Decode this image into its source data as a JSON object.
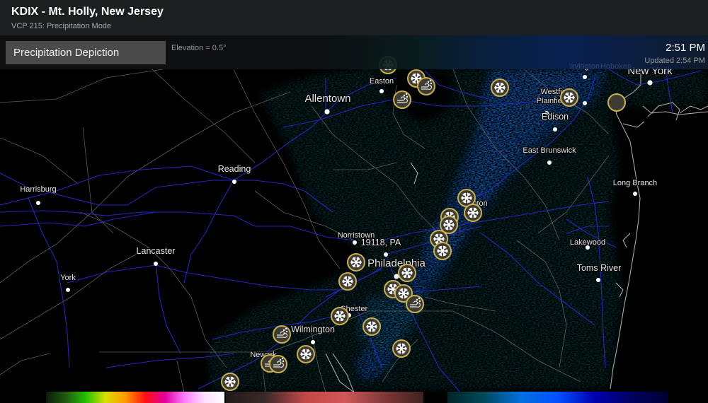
{
  "header": {
    "title": "KDIX - Mt. Holly, New Jersey",
    "subtitle": "VCP 215: Precipitation Mode"
  },
  "toolbar": {
    "product_button": "Precipitation Depiction",
    "elevation": "Elevation = 0.5°",
    "scan_time": "2:51 PM",
    "updated": "Updated 2:54 PM"
  },
  "map": {
    "cities": [
      {
        "name": "Allentown",
        "size": "large"
      },
      {
        "name": "Easton",
        "size": "small"
      },
      {
        "name": "Reading",
        "size": "medium"
      },
      {
        "name": "Harrisburg",
        "size": "small"
      },
      {
        "name": "Lancaster",
        "size": "medium"
      },
      {
        "name": "York",
        "size": "small"
      },
      {
        "name": "Norristown",
        "size": "small"
      },
      {
        "name": "19118, PA",
        "size": "medium"
      },
      {
        "name": "Philadelphia",
        "size": "large"
      },
      {
        "name": "Chester",
        "size": "small"
      },
      {
        "name": "Wilmington",
        "size": "medium"
      },
      {
        "name": "Newark",
        "size": "small"
      },
      {
        "name": "Trenton",
        "size": "small"
      },
      {
        "name": "New York",
        "size": "large"
      },
      {
        "name": "Irvington",
        "size": "small"
      },
      {
        "name": "Hoboken",
        "size": "small"
      },
      {
        "name": "Westfield",
        "size": "small"
      },
      {
        "name": "Plainfield",
        "size": "small"
      },
      {
        "name": "Edison",
        "size": "medium"
      },
      {
        "name": "East Brunswick",
        "size": "small"
      },
      {
        "name": "Long Branch",
        "size": "small"
      },
      {
        "name": "Lakewood",
        "size": "small"
      },
      {
        "name": "Toms River",
        "size": "medium"
      }
    ],
    "markers": [
      {
        "type": "snow"
      },
      {
        "type": "snow"
      },
      {
        "type": "blowing-snow"
      },
      {
        "type": "blowing-snow"
      },
      {
        "type": "snow"
      },
      {
        "type": "snow"
      },
      {
        "type": "empty"
      },
      {
        "type": "snow"
      },
      {
        "type": "snow"
      },
      {
        "type": "snow"
      },
      {
        "type": "snow"
      },
      {
        "type": "snow"
      },
      {
        "type": "snow"
      },
      {
        "type": "snow"
      },
      {
        "type": "snow"
      },
      {
        "type": "snow"
      },
      {
        "type": "snow"
      },
      {
        "type": "snow"
      },
      {
        "type": "blowing-snow"
      },
      {
        "type": "snow"
      },
      {
        "type": "snow"
      },
      {
        "type": "blowing-snow"
      },
      {
        "type": "snow"
      },
      {
        "type": "blowing-snow"
      },
      {
        "type": "blowing-snow"
      },
      {
        "type": "snow"
      },
      {
        "type": "snow"
      }
    ]
  },
  "legend": {
    "segments": [
      {
        "name": "rain",
        "colors": [
          "#0a1a0a",
          "#1e5a10",
          "#22c000",
          "#d8e000",
          "#ff9a00",
          "#ff1010",
          "#e000a0",
          "#ff80ff",
          "#ffe0ff",
          "#ffffff"
        ]
      },
      {
        "name": "mix",
        "colors": [
          "#201818",
          "#3a2a2a",
          "#c04848",
          "#d05858",
          "#803838",
          "#402020"
        ]
      },
      {
        "name": "snow",
        "colors": [
          "#002424",
          "#004a5a",
          "#0070e0",
          "#0050ff",
          "#0000b0",
          "#000060",
          "#000030"
        ]
      }
    ]
  },
  "colors": {
    "marker_fill": "#3e3a34",
    "marker_ring": "#c9b04a",
    "state_border": "#8a8a8a",
    "road": "#2a2ad0",
    "heavy_snow": "#1060ff",
    "light_snow": "#0c4a50"
  }
}
